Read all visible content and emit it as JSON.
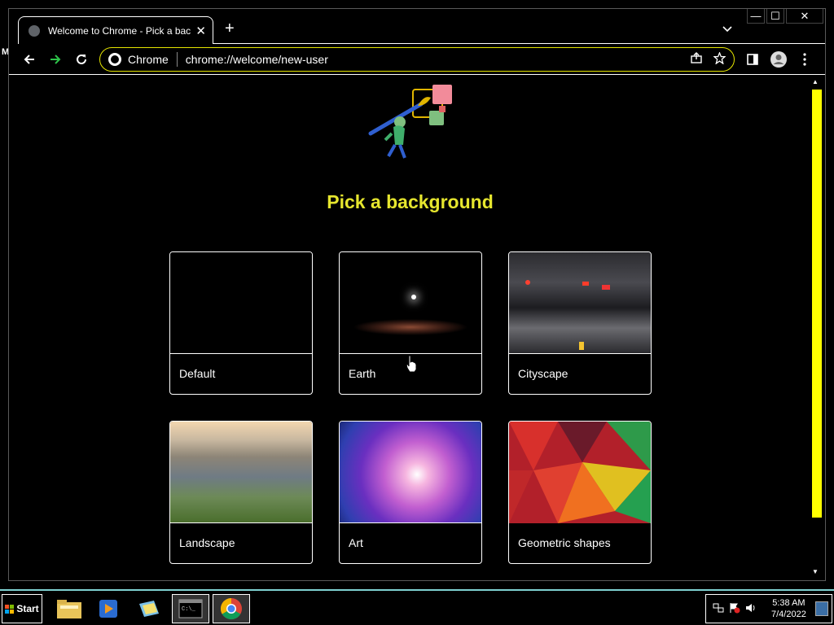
{
  "browser": {
    "tab_title": "Welcome to Chrome - Pick a background",
    "tab_close": "✕",
    "new_tab": "+",
    "tab_dropdown": "⌄",
    "window_controls": {
      "minimize": "—",
      "maximize": "☐",
      "close": "✕"
    },
    "omnibox_label": "Chrome",
    "url": "chrome://welcome/new-user",
    "accent_color": "#e6e600"
  },
  "page": {
    "heading": "Pick a background",
    "backgrounds": [
      {
        "label": "Default"
      },
      {
        "label": "Earth"
      },
      {
        "label": "Cityscape"
      },
      {
        "label": "Landscape"
      },
      {
        "label": "Art"
      },
      {
        "label": "Geometric shapes"
      }
    ]
  },
  "taskbar": {
    "start_label": "Start",
    "time": "5:38 AM",
    "date": "7/4/2022"
  },
  "desktop": {
    "edge_label": "M"
  }
}
